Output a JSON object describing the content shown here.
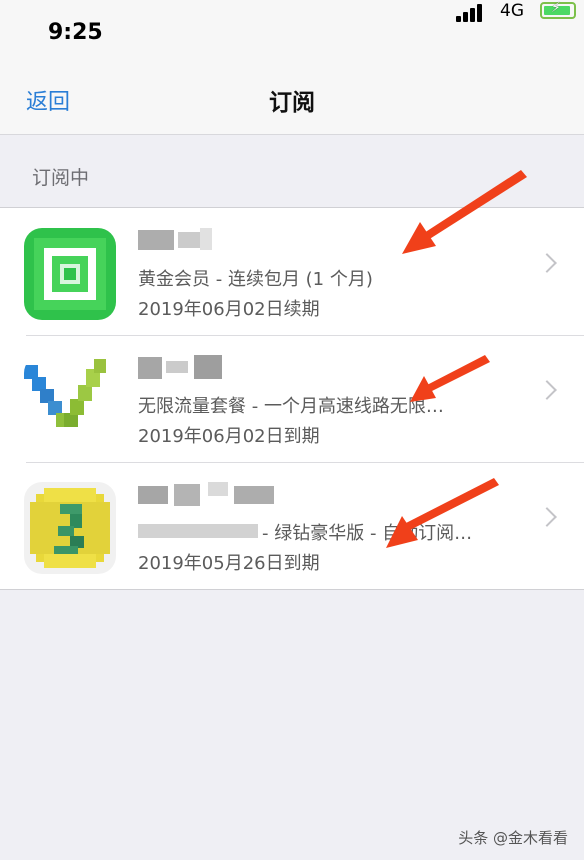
{
  "status_bar": {
    "time": "9:25",
    "network": "4G"
  },
  "nav": {
    "back_label": "返回",
    "title": "订阅"
  },
  "section": {
    "header": "订阅中"
  },
  "subscriptions": [
    {
      "subtitle": "黄金会员 - 连续包月 (1 个月)",
      "date": "2019年06月02日续期"
    },
    {
      "subtitle": "无限流量套餐 - 一个月高速线路无限…",
      "date": "2019年06月02日到期"
    },
    {
      "subtitle": "- 绿钻豪华版 - 自动订阅…",
      "date": "2019年05月26日到期"
    }
  ],
  "watermark": "头条 @金木看看",
  "colors": {
    "accent": "#2a7ed6",
    "arrow": "#f0401a"
  }
}
